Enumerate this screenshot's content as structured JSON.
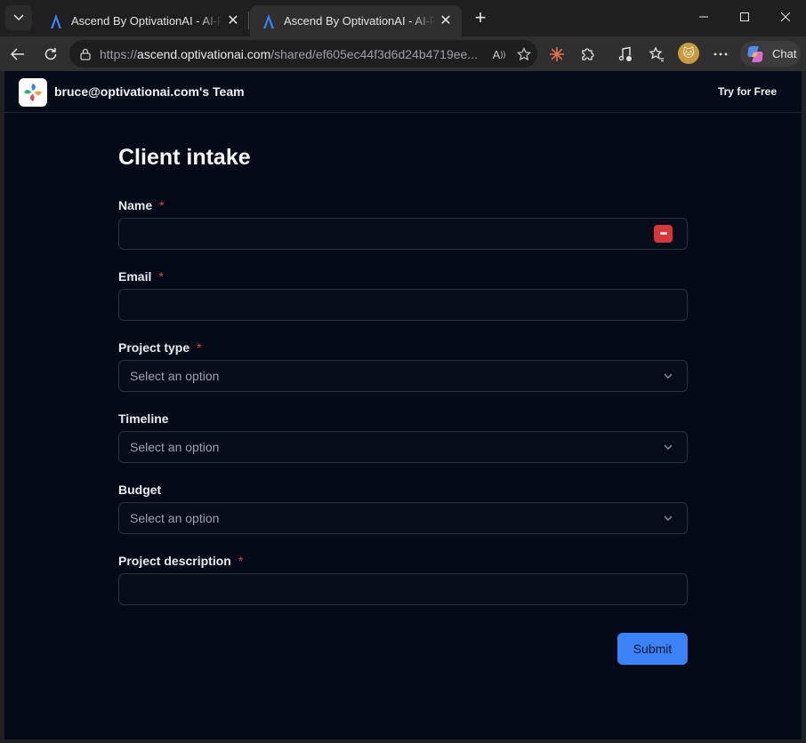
{
  "browser": {
    "tabs": [
      {
        "title": "Ascend By OptivationAI - AI-Powered",
        "active": false
      },
      {
        "title": "Ascend By OptivationAI - AI-Powered",
        "active": true
      }
    ],
    "url_prefix": "https://",
    "url_host": "ascend.optivationai.com",
    "url_path": "/shared/ef605ec44f3d6d24b4719ee...",
    "chat_label": "Chat",
    "read_aloud_label": "A"
  },
  "header": {
    "team_name": "bruce@optivationai.com's Team",
    "try_free": "Try for Free"
  },
  "form": {
    "title": "Client intake",
    "fields": [
      {
        "label": "Name",
        "required": "*",
        "type": "text",
        "value": ""
      },
      {
        "label": "Email",
        "required": "*",
        "type": "text",
        "value": ""
      },
      {
        "label": "Project type",
        "required": "*",
        "type": "select",
        "placeholder": "Select an option"
      },
      {
        "label": "Timeline",
        "required": "",
        "type": "select",
        "placeholder": "Select an option"
      },
      {
        "label": "Budget",
        "required": "",
        "type": "select",
        "placeholder": "Select an option"
      },
      {
        "label": "Project description",
        "required": "*",
        "type": "text",
        "value": ""
      }
    ],
    "submit_label": "Submit"
  },
  "colors": {
    "page_bg": "#050a18",
    "accent": "#3b82f6",
    "required": "#d9483b",
    "password_manager_badge": "#d6383a"
  }
}
